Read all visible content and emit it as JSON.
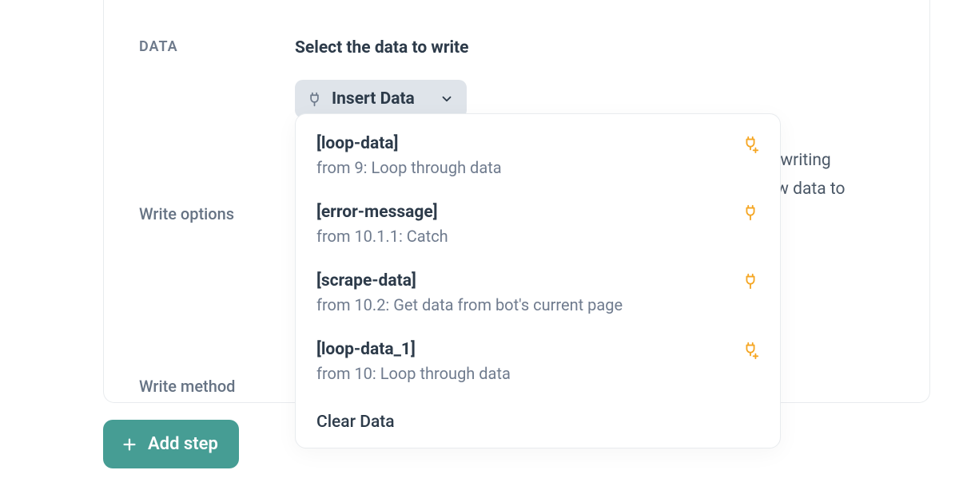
{
  "labels": {
    "data": "DATA",
    "write_options": "Write options",
    "write_method": "Write method"
  },
  "section_title": "Select the data to write",
  "insert_button": "Insert Data",
  "bg_line1": "e writing",
  "bg_line2": "ew data to",
  "dropdown": [
    {
      "title": "[loop-data]",
      "sub": "from 9: Loop through data",
      "icon": "plug-add"
    },
    {
      "title": "[error-message]",
      "sub": "from 10.1.1: Catch",
      "icon": "plug"
    },
    {
      "title": "[scrape-data]",
      "sub": "from 10.2: Get data from bot's current page",
      "icon": "plug"
    },
    {
      "title": "[loop-data_1]",
      "sub": "from 10: Loop through data",
      "icon": "plug-add"
    }
  ],
  "clear_label": "Clear Data",
  "add_step": "Add step",
  "colors": {
    "accent": "#f5a623",
    "teal": "#469d94"
  }
}
